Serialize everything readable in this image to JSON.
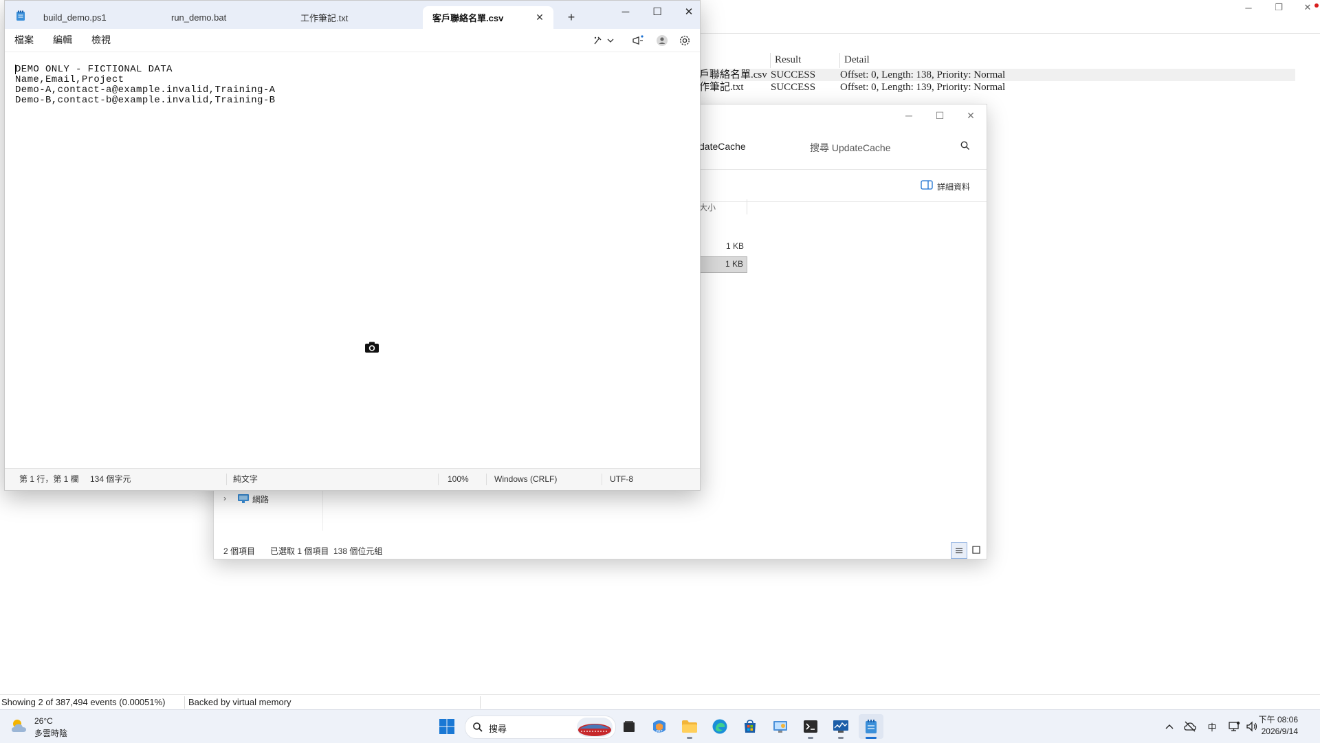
{
  "procmon": {
    "columns": [
      "Result",
      "Detail"
    ],
    "rows": [
      {
        "path": "戶聯絡名單.csv",
        "result": "SUCCESS",
        "detail": "Offset: 0, Length: 138, Priority: Normal"
      },
      {
        "path": "作筆記.txt",
        "result": "SUCCESS",
        "detail": "Offset: 0, Length: 139, Priority: Normal"
      }
    ],
    "status_events": "Showing 2 of 387,494 events (0.00051%)",
    "status_memory": "Backed by virtual memory"
  },
  "explorer": {
    "breadcrumb_tail": "dateCache",
    "search_placeholder": "搜尋 UpdateCache",
    "details_label": "詳細資料",
    "size_header": "大小",
    "sizes": [
      "1 KB",
      "1 KB"
    ],
    "nav_network": "網路",
    "status_count": "2 個項目",
    "status_selected": "已選取 1 個項目  138 個位元組"
  },
  "notepad": {
    "tabs": [
      "build_demo.ps1",
      "run_demo.bat",
      "工作筆記.txt",
      "客戶聯絡名單.csv"
    ],
    "new_tab": "+",
    "menu": [
      "檔案",
      "編輯",
      "檢視"
    ],
    "lines": [
      "DEMO ONLY - FICTIONAL DATA",
      "Name,Email,Project",
      "Demo-A,contact-a@example.invalid,Training-A",
      "Demo-B,contact-b@example.invalid,Training-B"
    ],
    "status": {
      "position": "第 1 行，第 1 欄",
      "chars": "134 個字元",
      "format": "純文字",
      "zoom": "100%",
      "line_ending": "Windows (CRLF)",
      "encoding": "UTF-8"
    }
  },
  "taskbar": {
    "weather_temp": "26°C",
    "weather_desc": "多雲時陰",
    "search_label": "搜尋",
    "ime": "中",
    "time": "下午 08:06",
    "date": "2026/9/14"
  }
}
